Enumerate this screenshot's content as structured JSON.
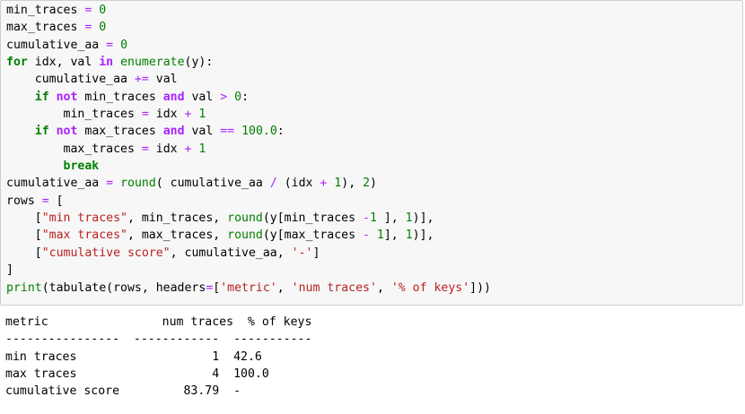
{
  "code_cell": {
    "lines": [
      [
        {
          "t": "min_traces ",
          "c": "pu"
        },
        {
          "t": "=",
          "c": "op"
        },
        {
          "t": " ",
          "c": "pu"
        },
        {
          "t": "0",
          "c": "num"
        }
      ],
      [
        {
          "t": "max_traces ",
          "c": "pu"
        },
        {
          "t": "=",
          "c": "op"
        },
        {
          "t": " ",
          "c": "pu"
        },
        {
          "t": "0",
          "c": "num"
        }
      ],
      [
        {
          "t": "cumulative_aa ",
          "c": "pu"
        },
        {
          "t": "=",
          "c": "op"
        },
        {
          "t": " ",
          "c": "pu"
        },
        {
          "t": "0",
          "c": "num"
        }
      ],
      [
        {
          "t": "for",
          "c": "kw"
        },
        {
          "t": " idx, val ",
          "c": "pu"
        },
        {
          "t": "in",
          "c": "ow"
        },
        {
          "t": " ",
          "c": "pu"
        },
        {
          "t": "enumerate",
          "c": "bi"
        },
        {
          "t": "(y):",
          "c": "pu"
        }
      ],
      [
        {
          "t": "    cumulative_aa ",
          "c": "pu"
        },
        {
          "t": "+=",
          "c": "op"
        },
        {
          "t": " val",
          "c": "pu"
        }
      ],
      [
        {
          "t": "    ",
          "c": "pu"
        },
        {
          "t": "if",
          "c": "kw"
        },
        {
          "t": " ",
          "c": "pu"
        },
        {
          "t": "not",
          "c": "ow"
        },
        {
          "t": " min_traces ",
          "c": "pu"
        },
        {
          "t": "and",
          "c": "ow"
        },
        {
          "t": " val ",
          "c": "pu"
        },
        {
          "t": ">",
          "c": "op"
        },
        {
          "t": " ",
          "c": "pu"
        },
        {
          "t": "0",
          "c": "num"
        },
        {
          "t": ":",
          "c": "pu"
        }
      ],
      [
        {
          "t": "        min_traces ",
          "c": "pu"
        },
        {
          "t": "=",
          "c": "op"
        },
        {
          "t": " idx ",
          "c": "pu"
        },
        {
          "t": "+",
          "c": "op"
        },
        {
          "t": " ",
          "c": "pu"
        },
        {
          "t": "1",
          "c": "num"
        }
      ],
      [
        {
          "t": "    ",
          "c": "pu"
        },
        {
          "t": "if",
          "c": "kw"
        },
        {
          "t": " ",
          "c": "pu"
        },
        {
          "t": "not",
          "c": "ow"
        },
        {
          "t": " max_traces ",
          "c": "pu"
        },
        {
          "t": "and",
          "c": "ow"
        },
        {
          "t": " val ",
          "c": "pu"
        },
        {
          "t": "==",
          "c": "op"
        },
        {
          "t": " ",
          "c": "pu"
        },
        {
          "t": "100.0",
          "c": "num"
        },
        {
          "t": ":",
          "c": "pu"
        }
      ],
      [
        {
          "t": "        max_traces ",
          "c": "pu"
        },
        {
          "t": "=",
          "c": "op"
        },
        {
          "t": " idx ",
          "c": "pu"
        },
        {
          "t": "+",
          "c": "op"
        },
        {
          "t": " ",
          "c": "pu"
        },
        {
          "t": "1",
          "c": "num"
        }
      ],
      [
        {
          "t": "        ",
          "c": "pu"
        },
        {
          "t": "break",
          "c": "kw"
        }
      ],
      [
        {
          "t": "cumulative_aa ",
          "c": "pu"
        },
        {
          "t": "=",
          "c": "op"
        },
        {
          "t": " ",
          "c": "pu"
        },
        {
          "t": "round",
          "c": "bi"
        },
        {
          "t": "( cumulative_aa ",
          "c": "pu"
        },
        {
          "t": "/",
          "c": "op"
        },
        {
          "t": " (idx ",
          "c": "pu"
        },
        {
          "t": "+",
          "c": "op"
        },
        {
          "t": " ",
          "c": "pu"
        },
        {
          "t": "1",
          "c": "num"
        },
        {
          "t": "), ",
          "c": "pu"
        },
        {
          "t": "2",
          "c": "num"
        },
        {
          "t": ")",
          "c": "pu"
        }
      ],
      [
        {
          "t": "rows ",
          "c": "pu"
        },
        {
          "t": "=",
          "c": "op"
        },
        {
          "t": " [",
          "c": "pu"
        }
      ],
      [
        {
          "t": "    [",
          "c": "pu"
        },
        {
          "t": "\"min traces\"",
          "c": "str"
        },
        {
          "t": ", min_traces, ",
          "c": "pu"
        },
        {
          "t": "round",
          "c": "bi"
        },
        {
          "t": "(y[min_traces ",
          "c": "pu"
        },
        {
          "t": "-",
          "c": "op"
        },
        {
          "t": "1",
          "c": "num"
        },
        {
          "t": " ], ",
          "c": "pu"
        },
        {
          "t": "1",
          "c": "num"
        },
        {
          "t": ")],",
          "c": "pu"
        }
      ],
      [
        {
          "t": "    [",
          "c": "pu"
        },
        {
          "t": "\"max traces\"",
          "c": "str"
        },
        {
          "t": ", max_traces, ",
          "c": "pu"
        },
        {
          "t": "round",
          "c": "bi"
        },
        {
          "t": "(y[max_traces ",
          "c": "pu"
        },
        {
          "t": "-",
          "c": "op"
        },
        {
          "t": " ",
          "c": "pu"
        },
        {
          "t": "1",
          "c": "num"
        },
        {
          "t": "], ",
          "c": "pu"
        },
        {
          "t": "1",
          "c": "num"
        },
        {
          "t": ")],",
          "c": "pu"
        }
      ],
      [
        {
          "t": "    [",
          "c": "pu"
        },
        {
          "t": "\"cumulative score\"",
          "c": "str"
        },
        {
          "t": ", cumulative_aa, ",
          "c": "pu"
        },
        {
          "t": "'-'",
          "c": "str"
        },
        {
          "t": "]",
          "c": "pu"
        }
      ],
      [
        {
          "t": "]",
          "c": "pu"
        }
      ],
      [
        {
          "t": "print",
          "c": "bi"
        },
        {
          "t": "(tabulate(rows, headers",
          "c": "pu"
        },
        {
          "t": "=",
          "c": "op"
        },
        {
          "t": "[",
          "c": "pu"
        },
        {
          "t": "'metric'",
          "c": "str"
        },
        {
          "t": ", ",
          "c": "pu"
        },
        {
          "t": "'num traces'",
          "c": "str"
        },
        {
          "t": ", ",
          "c": "pu"
        },
        {
          "t": "'% of keys'",
          "c": "str"
        },
        {
          "t": "]))",
          "c": "pu"
        }
      ]
    ]
  },
  "output_cell": {
    "lines": [
      "metric                num traces  % of keys",
      "----------------  ------------  -----------",
      "min traces                   1  42.6",
      "max traces                   4  100.0",
      "cumulative score         83.79  -"
    ]
  },
  "colors": {
    "keyword": "#008000",
    "operator": "#aa22ff",
    "string": "#ba2121",
    "number": "#008000",
    "cell_background": "#f7f7f7",
    "cell_border": "#cfcfcf"
  }
}
